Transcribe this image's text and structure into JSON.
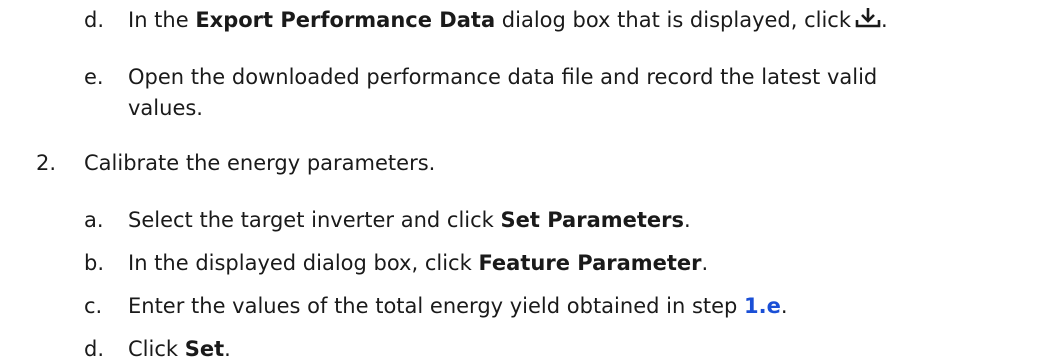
{
  "steps": {
    "d": {
      "marker": "d.",
      "t1": "In the ",
      "b1": "Export Performance Data",
      "t2": " dialog box that is displayed, click",
      "t3": ".",
      "icon": "download-icon"
    },
    "e": {
      "marker": "e.",
      "line1": "Open the downloaded performance data file and record the latest valid",
      "line2": "values."
    },
    "s2": {
      "marker": "2.",
      "text": "Calibrate the energy parameters."
    },
    "a": {
      "marker": "a.",
      "t1": "Select the target inverter and click ",
      "b1": "Set Parameters",
      "t2": "."
    },
    "b": {
      "marker": "b.",
      "t1": "In the displayed dialog box, click ",
      "b1": "Feature Parameter",
      "t2": "."
    },
    "c": {
      "marker": "c.",
      "t1": "Enter the values of the total energy yield obtained in step ",
      "link": "1.e",
      "t2": "."
    },
    "d2": {
      "marker": "d.",
      "t1": "Click ",
      "b1": "Set",
      "t2": "."
    }
  }
}
